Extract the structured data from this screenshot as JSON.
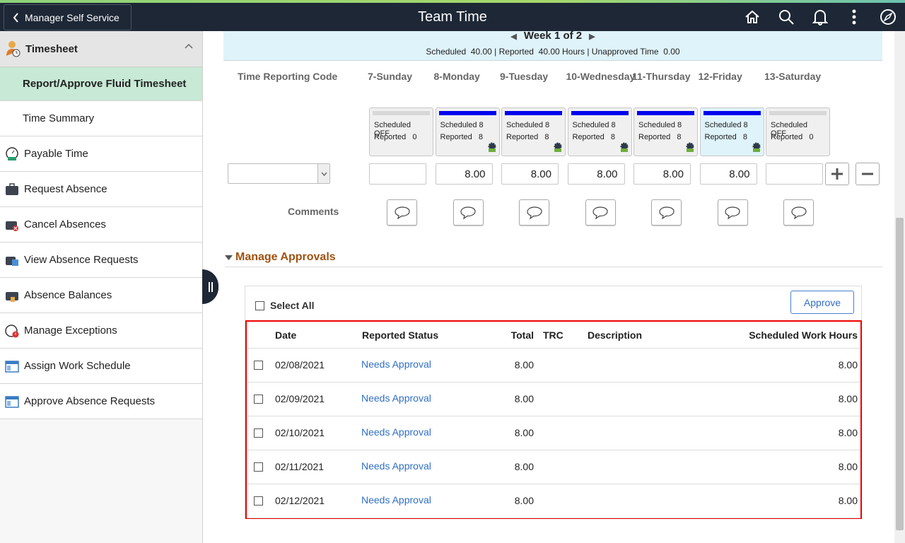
{
  "header": {
    "back_label": "Manager Self Service",
    "title": "Team Time",
    "icons": [
      "home-icon",
      "search-icon",
      "bell-icon",
      "more-vertical-icon",
      "compass-icon"
    ]
  },
  "sidebar": {
    "group": "Timesheet",
    "items": [
      {
        "label": "Report/Approve Fluid Timesheet",
        "selected": true
      },
      {
        "label": "Time Summary"
      },
      {
        "label": "Payable Time",
        "icon": "payable-time-icon"
      },
      {
        "label": "Request Absence",
        "icon": "briefcase-icon"
      },
      {
        "label": "Cancel Absences",
        "icon": "briefcase-cancel-icon"
      },
      {
        "label": "View Absence Requests",
        "icon": "briefcase-calendar-icon"
      },
      {
        "label": "Absence Balances",
        "icon": "briefcase-balance-icon"
      },
      {
        "label": "Manage Exceptions",
        "icon": "exception-clock-icon"
      },
      {
        "label": "Assign Work Schedule",
        "icon": "schedule-window-icon"
      },
      {
        "label": "Approve Absence Requests",
        "icon": "schedule-window-icon"
      }
    ]
  },
  "banner": {
    "week": "Week 1 of 2",
    "summary": "Scheduled  40.00 | Reported  40.00 Hours | Unapproved Time  0.00"
  },
  "grid": {
    "trc_header": "Time Reporting Code",
    "days": [
      {
        "label": "7-Sunday",
        "scheduled": "Scheduled OFF",
        "reported": "Reported   0",
        "value": "",
        "work": false
      },
      {
        "label": "8-Monday",
        "scheduled": "Scheduled 8",
        "reported": "Reported   8",
        "value": "8.00",
        "work": true
      },
      {
        "label": "9-Tuesday",
        "scheduled": "Scheduled 8",
        "reported": "Reported   8",
        "value": "8.00",
        "work": true
      },
      {
        "label": "10-Wednesday",
        "scheduled": "Scheduled 8",
        "reported": "Reported   8",
        "value": "8.00",
        "work": true
      },
      {
        "label": "11-Thursday",
        "scheduled": "Scheduled 8",
        "reported": "Reported   8",
        "value": "8.00",
        "work": true
      },
      {
        "label": "12-Friday",
        "scheduled": "Scheduled 8",
        "reported": "Reported   8",
        "value": "8.00",
        "work": true,
        "current": true
      },
      {
        "label": "13-Saturday",
        "scheduled": "Scheduled OFF",
        "reported": "Reported   0",
        "value": "",
        "work": false
      }
    ],
    "comments_label": "Comments"
  },
  "approvals": {
    "section_title": "Manage Approvals",
    "select_all": "Select All",
    "approve_button": "Approve",
    "columns": [
      "Date",
      "Reported Status",
      "Total",
      "TRC",
      "Description",
      "Scheduled Work Hours"
    ],
    "rows": [
      {
        "date": "02/08/2021",
        "status": "Needs Approval",
        "total": "8.00",
        "trc": "",
        "description": "",
        "scheduled": "8.00"
      },
      {
        "date": "02/09/2021",
        "status": "Needs Approval",
        "total": "8.00",
        "trc": "",
        "description": "",
        "scheduled": "8.00"
      },
      {
        "date": "02/10/2021",
        "status": "Needs Approval",
        "total": "8.00",
        "trc": "",
        "description": "",
        "scheduled": "8.00"
      },
      {
        "date": "02/11/2021",
        "status": "Needs Approval",
        "total": "8.00",
        "trc": "",
        "description": "",
        "scheduled": "8.00"
      },
      {
        "date": "02/12/2021",
        "status": "Needs Approval",
        "total": "8.00",
        "trc": "",
        "description": "",
        "scheduled": "8.00"
      }
    ]
  },
  "colors": {
    "header_bg": "#1d2735",
    "selected_item": "#c7e9d5",
    "banner": "#dff3fb",
    "link": "#2f6fc7",
    "section_title": "#a0520f",
    "highlight_border": "#e00000",
    "scheduled_bar": "#0000ee"
  }
}
